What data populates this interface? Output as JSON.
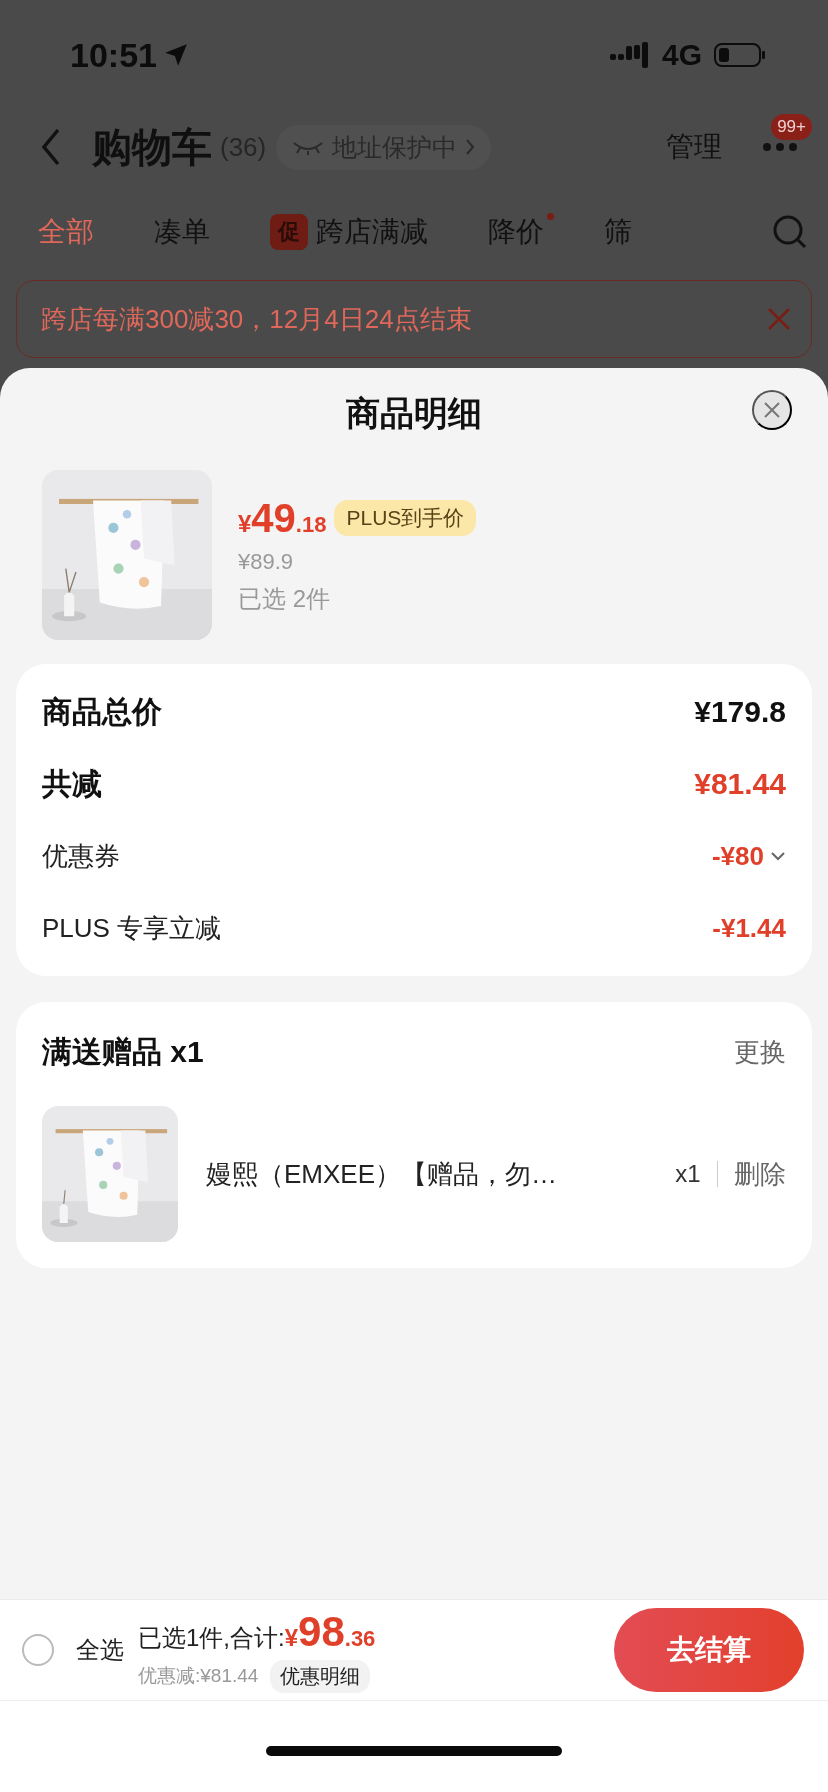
{
  "status_bar": {
    "time": "10:51",
    "network": "4G"
  },
  "header": {
    "title": "购物车",
    "count": "(36)",
    "address_label": "地址保护中",
    "manage": "管理",
    "badge": "99+"
  },
  "tabs": [
    {
      "label": "全部",
      "selected": true,
      "dot": false
    },
    {
      "label": "凑单",
      "selected": false,
      "dot": false
    },
    {
      "label": "跨店满减",
      "tag": "促",
      "selected": false,
      "dot": false
    },
    {
      "label": "降价",
      "selected": false,
      "dot": true
    },
    {
      "label": "筛",
      "selected": false,
      "dot": false
    }
  ],
  "banner": {
    "text": "跨店每满300减30，12月4日24点结束"
  },
  "sheet": {
    "title": "商品明细",
    "product": {
      "price_symbol": "¥",
      "price_int": "49",
      "price_dec": ".18",
      "plus_tag": "PLUS到手价",
      "original_price": "¥89.9",
      "selected_count": "已选 2件"
    },
    "summary": [
      {
        "label": "商品总价",
        "value": "¥179.8",
        "kind": "total",
        "expandable": false
      },
      {
        "label": "共减",
        "value": "¥81.44",
        "kind": "reduction",
        "expandable": false
      },
      {
        "label": "优惠券",
        "value": "-¥80",
        "kind": "discount",
        "expandable": true
      },
      {
        "label": "PLUS 专享立减",
        "value": "-¥1.44",
        "kind": "discount",
        "expandable": false
      }
    ],
    "gifts": {
      "title": "满送赠品 x1",
      "action": "更换",
      "items": [
        {
          "name": "嫚熙（EMXEE）【赠品，勿…",
          "quantity": "x1",
          "delete": "删除"
        }
      ]
    }
  },
  "footer": {
    "select_all": {
      "label": "全选",
      "checked": false
    },
    "summary_label": "已选1件,合计:",
    "total_symbol": "¥",
    "total_int": "98",
    "total_dec": ".36",
    "discount_label": "优惠减:¥81.44",
    "detail_button": "优惠明细",
    "checkout": "去结算"
  }
}
